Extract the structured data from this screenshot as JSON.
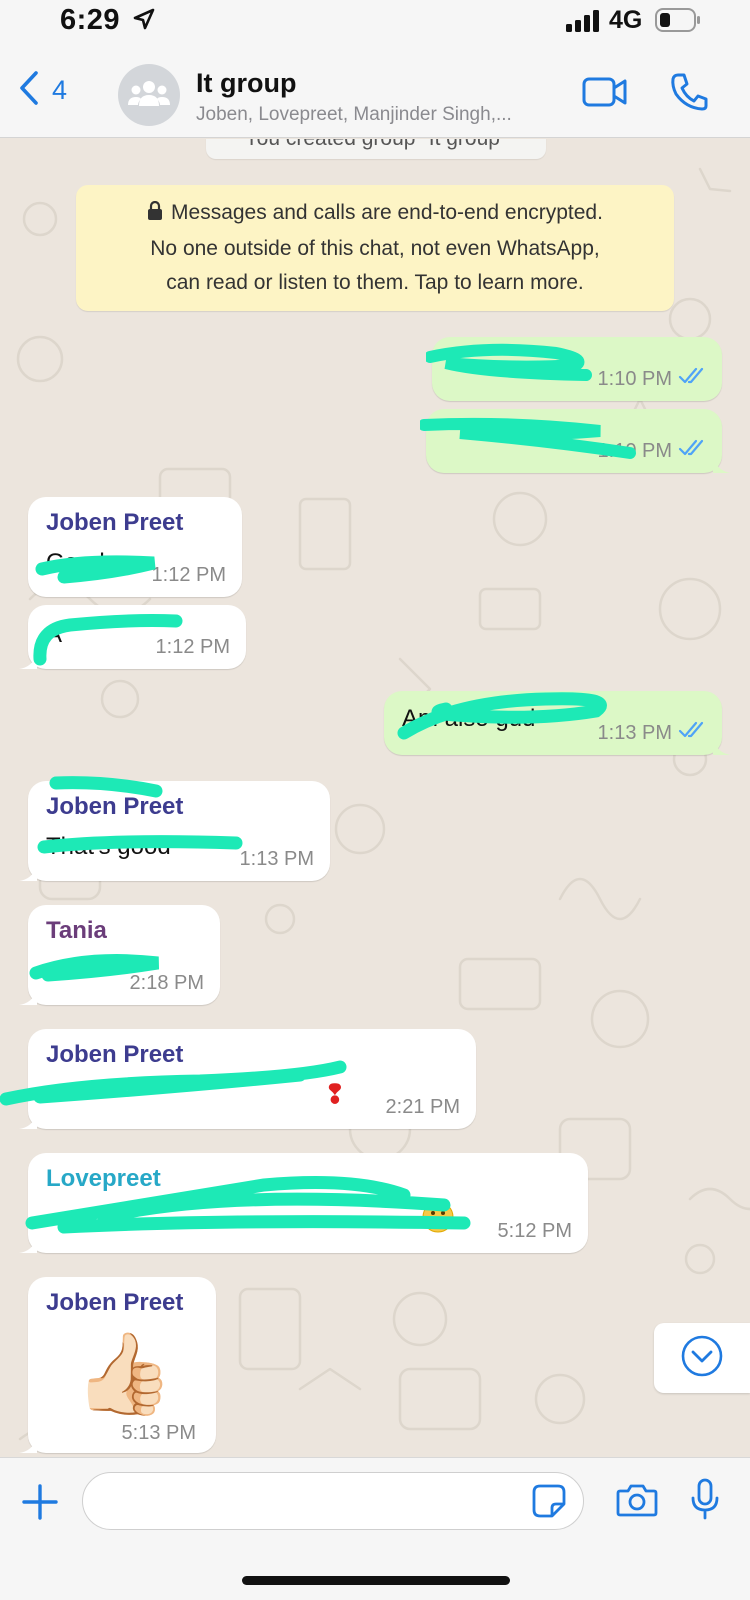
{
  "status_bar": {
    "time": "6:29",
    "network": "4G"
  },
  "header": {
    "back_count": "4",
    "title": "It group",
    "subtitle": "Joben, Lovepreet, Manjinder Singh,..."
  },
  "system": {
    "group_created": "You created group \"It group\"",
    "encryption_line1": "Messages and calls are end-to-end encrypted.",
    "encryption_line2": "No one outside of this chat, not even WhatsApp,",
    "encryption_line3": "can read or listen to them. Tap to learn more."
  },
  "messages": [
    {
      "direction": "out",
      "sender": "",
      "text": "",
      "time": "1:10 PM",
      "read": true
    },
    {
      "direction": "out",
      "sender": "",
      "text": "",
      "time": "1:10 PM",
      "read": true
    },
    {
      "direction": "in",
      "sender": "Joben Preet",
      "text": "Good",
      "time": "1:12 PM"
    },
    {
      "direction": "in",
      "sender": "",
      "text": "A",
      "time": "1:12 PM"
    },
    {
      "direction": "out",
      "sender": "",
      "text": "Am also gud",
      "time": "1:13 PM",
      "read": true
    },
    {
      "direction": "in",
      "sender": "Joben Preet",
      "text": "That's good",
      "time": "1:13 PM"
    },
    {
      "direction": "in",
      "sender": "Tania",
      "text": "",
      "time": "2:18 PM"
    },
    {
      "direction": "in",
      "sender": "Joben Preet",
      "text": "",
      "time": "2:21 PM"
    },
    {
      "direction": "in",
      "sender": "Lovepreet",
      "text": "",
      "time": "5:12 PM"
    },
    {
      "direction": "in",
      "sender": "Joben Preet",
      "text": "👍🏻",
      "time": "5:13 PM"
    }
  ],
  "colors": {
    "accent": "#1f7ae0",
    "outgoing_bubble": "#dcf8c6",
    "incoming_bubble": "#ffffff",
    "chat_background": "#ece5dd",
    "encryption_notice": "#fdf4c5",
    "sender_joben": "#3d3c8f",
    "sender_tania": "#6b3d7a",
    "sender_lovepreet": "#27a8c7",
    "redaction": "#1de9b6",
    "read_ticks": "#4fa3f7"
  },
  "icons": {
    "back": "chevron-left-icon",
    "avatar": "group-icon",
    "video": "video-camera-icon",
    "call": "phone-icon",
    "scroll_down": "chevron-down-circle-icon",
    "attach": "plus-icon",
    "sticker": "sticker-icon",
    "camera": "camera-icon",
    "mic": "microphone-icon"
  },
  "composer": {
    "placeholder": ""
  }
}
